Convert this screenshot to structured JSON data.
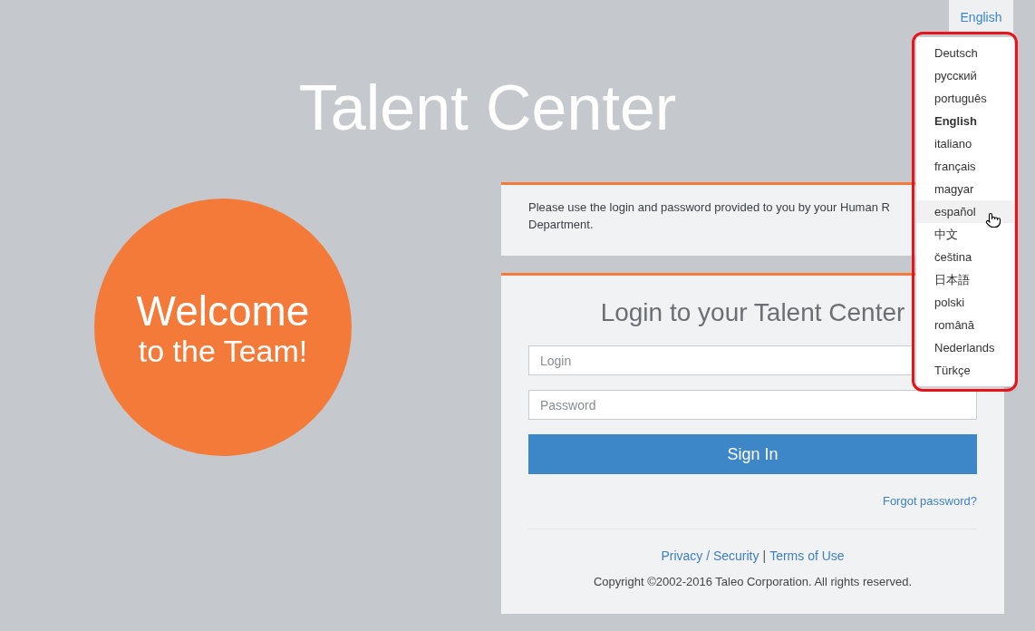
{
  "language_menu": {
    "current": "English",
    "highlighted": true,
    "items": [
      {
        "label": "Deutsch",
        "selected": false,
        "hovered": false
      },
      {
        "label": "русский",
        "selected": false,
        "hovered": false
      },
      {
        "label": "português",
        "selected": false,
        "hovered": false
      },
      {
        "label": "English",
        "selected": true,
        "hovered": false
      },
      {
        "label": "italiano",
        "selected": false,
        "hovered": false
      },
      {
        "label": "français",
        "selected": false,
        "hovered": false
      },
      {
        "label": "magyar",
        "selected": false,
        "hovered": false
      },
      {
        "label": "español",
        "selected": false,
        "hovered": true
      },
      {
        "label": "中文",
        "selected": false,
        "hovered": false
      },
      {
        "label": "čeština",
        "selected": false,
        "hovered": false
      },
      {
        "label": "日本語",
        "selected": false,
        "hovered": false
      },
      {
        "label": "polski",
        "selected": false,
        "hovered": false
      },
      {
        "label": "română",
        "selected": false,
        "hovered": false
      },
      {
        "label": "Nederlands",
        "selected": false,
        "hovered": false
      },
      {
        "label": "Türkçe",
        "selected": false,
        "hovered": false
      }
    ]
  },
  "title": "Talent Center",
  "welcome": {
    "line_1": "Welcome",
    "line_2": "to the Team!"
  },
  "notice": {
    "lines": [
      "Please use the login and password provided to you by your Human R",
      "Department."
    ]
  },
  "login": {
    "heading": "Login to your Talent Center",
    "fields": [
      {
        "placeholder": "Login"
      },
      {
        "placeholder": "Password"
      }
    ],
    "submit": "Sign In",
    "forgot_link": "Forgot password?",
    "footer_links": [
      "Privacy / Security",
      "Terms of Use"
    ],
    "separator": "|",
    "copyright": "Copyright ©2002-2016 Taleo Corporation. All rights reserved."
  }
}
